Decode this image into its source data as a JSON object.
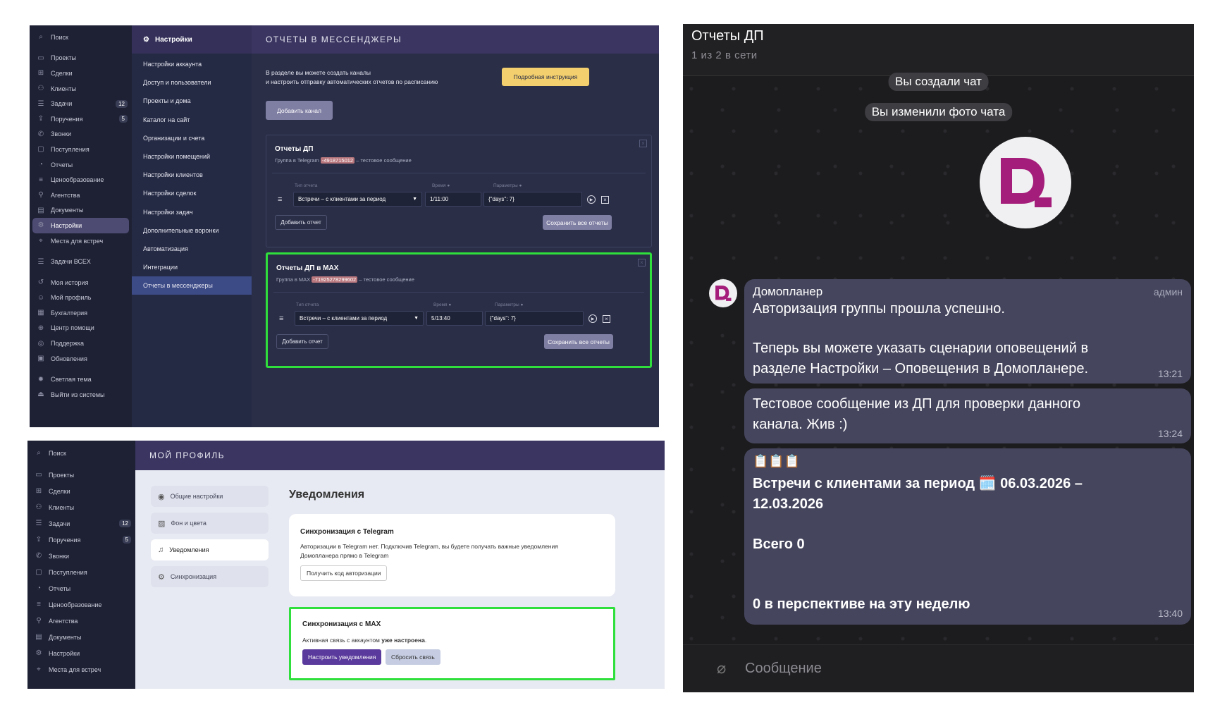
{
  "sidebar1": {
    "search": "Поиск",
    "items": [
      {
        "label": "Проекты",
        "icon": "folder-icon"
      },
      {
        "label": "Сделки",
        "icon": "handshake-icon"
      },
      {
        "label": "Клиенты",
        "icon": "users-icon"
      },
      {
        "label": "Задачи",
        "icon": "list-icon",
        "badge": "12"
      },
      {
        "label": "Поручения",
        "icon": "assign-icon",
        "badge": "5"
      },
      {
        "label": "Звонки",
        "icon": "phone-icon"
      },
      {
        "label": "Поступления",
        "icon": "inbox-icon"
      },
      {
        "label": "Отчеты",
        "icon": "chart-icon"
      },
      {
        "label": "Ценообразование",
        "icon": "price-icon"
      },
      {
        "label": "Агентства",
        "icon": "agency-icon"
      },
      {
        "label": "Документы",
        "icon": "docs-icon"
      },
      {
        "label": "Настройки",
        "icon": "gear-icon"
      },
      {
        "label": "Места для встреч",
        "icon": "pin-icon"
      }
    ],
    "items_b": [
      {
        "label": "Задачи ВСЕХ",
        "icon": "list-icon"
      }
    ],
    "items_c": [
      {
        "label": "Моя история",
        "icon": "history-icon"
      },
      {
        "label": "Мой профиль",
        "icon": "profile-icon"
      },
      {
        "label": "Бухгалтерия",
        "icon": "accounting-icon"
      },
      {
        "label": "Центр помощи",
        "icon": "help-icon"
      },
      {
        "label": "Поддержка",
        "icon": "support-icon"
      },
      {
        "label": "Обновления",
        "icon": "updates-icon"
      }
    ],
    "items_d": [
      {
        "label": "Светлая тема",
        "icon": "theme-icon"
      },
      {
        "label": "Выйти из системы",
        "icon": "exit-icon"
      }
    ]
  },
  "settings_menu": {
    "header": "Настройки",
    "items": [
      "Настройки аккаунта",
      "Доступ и пользователи",
      "Проекты и дома",
      "Каталог на сайт",
      "Организации и счета",
      "Настройки помещений",
      "Настройки клиентов",
      "Настройки сделок",
      "Настройки задач",
      "Дополнительные воронки",
      "Автоматизация",
      "Интеграции",
      "Отчеты в мессенджеры"
    ]
  },
  "messenger_reports": {
    "title": "ОТЧЕТЫ В МЕССЕНДЖЕРЫ",
    "intro_line1": "В разделе вы можете создать каналы",
    "intro_line2": "и настроить отправку автоматических отчетов по расписанию",
    "instruction_btn": "Подробная инструкция",
    "add_channel_btn": "Добавить канал",
    "lbl_type": "Тип отчета",
    "lbl_time": "Время",
    "lbl_params": "Параметры",
    "add_report_btn": "Добавить отчет",
    "save_all_btn": "Сохранить все отчеты",
    "test_msg": "– тестовое сообщение",
    "channels": [
      {
        "name": "Отчеты ДП",
        "group_prefix": "Группа в Telegram",
        "token": "-4918715012",
        "type": "Встречи – с клиентами за период",
        "time": "1/11:00",
        "params": "{\"days\": 7}"
      },
      {
        "name": "Отчеты ДП в MAX",
        "group_prefix": "Группа в MAX",
        "token": "-71925278299602",
        "type": "Встречи – с клиентами за период",
        "time": "5/13:40",
        "params": "{\"days\": 7}"
      }
    ]
  },
  "sidebar2": {
    "search": "Поиск",
    "items": [
      {
        "label": "Проекты",
        "icon": "folder-icon"
      },
      {
        "label": "Сделки",
        "icon": "handshake-icon"
      },
      {
        "label": "Клиенты",
        "icon": "users-icon"
      },
      {
        "label": "Задачи",
        "icon": "list-icon",
        "badge": "12"
      },
      {
        "label": "Поручения",
        "icon": "assign-icon",
        "badge": "5"
      },
      {
        "label": "Звонки",
        "icon": "phone-icon"
      },
      {
        "label": "Поступления",
        "icon": "inbox-icon"
      },
      {
        "label": "Отчеты",
        "icon": "chart-icon"
      },
      {
        "label": "Ценообразование",
        "icon": "price-icon"
      },
      {
        "label": "Агентства",
        "icon": "agency-icon"
      },
      {
        "label": "Документы",
        "icon": "docs-icon"
      },
      {
        "label": "Настройки",
        "icon": "gear-icon"
      },
      {
        "label": "Места для встреч",
        "icon": "pin-icon"
      }
    ]
  },
  "profile": {
    "title": "МОЙ ПРОФИЛЬ",
    "menu": [
      {
        "label": "Общие настройки",
        "icon": "user-circle-icon"
      },
      {
        "label": "Фон и цвета",
        "icon": "image-icon"
      },
      {
        "label": "Уведомления",
        "icon": "bell-icon"
      },
      {
        "label": "Синхронизация",
        "icon": "gear-icon"
      }
    ],
    "section_title": "Уведомления",
    "tg": {
      "title": "Синхронизация с Telegram",
      "text1": "Авторизации в Telegram нет. Подключив Telegram, вы будете получать важные уведомления",
      "text2": "Домопланера прямо в Telegram",
      "button": "Получить код авторизации"
    },
    "max": {
      "title": "Синхронизация с MAX",
      "text_a": "Активная связь с аккаунтом ",
      "text_b": "уже настроена",
      "text_c": ".",
      "btn_setup": "Настроить уведомления",
      "btn_reset": "Сбросить связь"
    }
  },
  "chat": {
    "title": "Отчеты ДП",
    "subtitle": "1 из 2 в сети",
    "sys1": "Вы создали чат",
    "sys2": "Вы изменили фото чата",
    "sender": "Домопланер",
    "role": "админ",
    "m1_l1": "Авторизация группы прошла успешно.",
    "m1_l2": "Теперь вы можете указать сценарии оповещений в",
    "m1_l3": "разделе Настройки – Оповещения в Домопланере.",
    "m1_time": "13:21",
    "m2_l1": "Тестовое сообщение из ДП для проверки данного",
    "m2_l2": "канала. Жив :)",
    "m2_time": "13:24",
    "m3_emoji": "📋📋📋",
    "m3_l1": "Встречи с клиентами за период 🗓️ 06.03.2026 –",
    "m3_l2": "12.03.2026",
    "m3_l3": "Всего 0",
    "m3_l4": "0 в перспективе на эту неделю",
    "m3_time": "13:40",
    "input_placeholder": "Сообщение"
  }
}
